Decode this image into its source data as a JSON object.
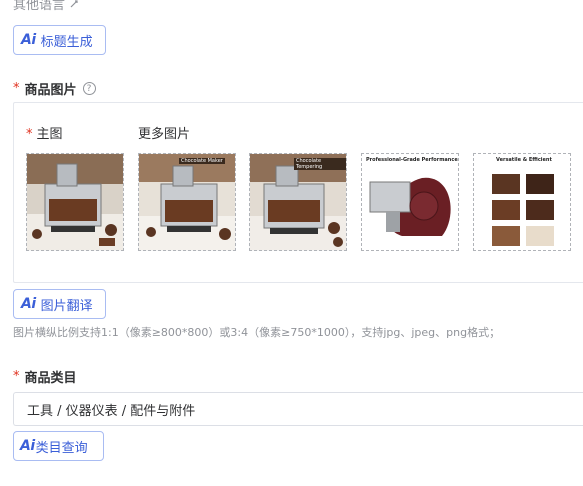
{
  "top": {
    "other_languages": "其他语言"
  },
  "ai_prefix": "Ai",
  "buttons": {
    "title_generate": "标题生成",
    "image_translate": "图片翻译",
    "category_query": "类目查询"
  },
  "product_images": {
    "label": "商品图片",
    "main_label": "主图",
    "more_label": "更多图片",
    "hint": "图片横纵比例支持1:1（像素≥800*800）或3:4（像素≥750*1000），支持jpg、jpeg、png格式；",
    "thumbs": [
      {
        "name": "main",
        "caption": ""
      },
      {
        "name": "more-1",
        "caption": "Chocolate Maker"
      },
      {
        "name": "more-2",
        "caption": "Chocolate Tempering"
      },
      {
        "name": "more-3",
        "caption": "Professional-Grade Performance"
      },
      {
        "name": "more-4",
        "caption": "Versatile & Efficient"
      }
    ]
  },
  "category": {
    "label": "商品类目",
    "value": "工具 / 仪器仪表 / 配件与附件"
  },
  "required_mark": "*",
  "help_glyph": "?",
  "colors": {
    "accent": "#3b5fd8",
    "required": "#e0301e"
  }
}
